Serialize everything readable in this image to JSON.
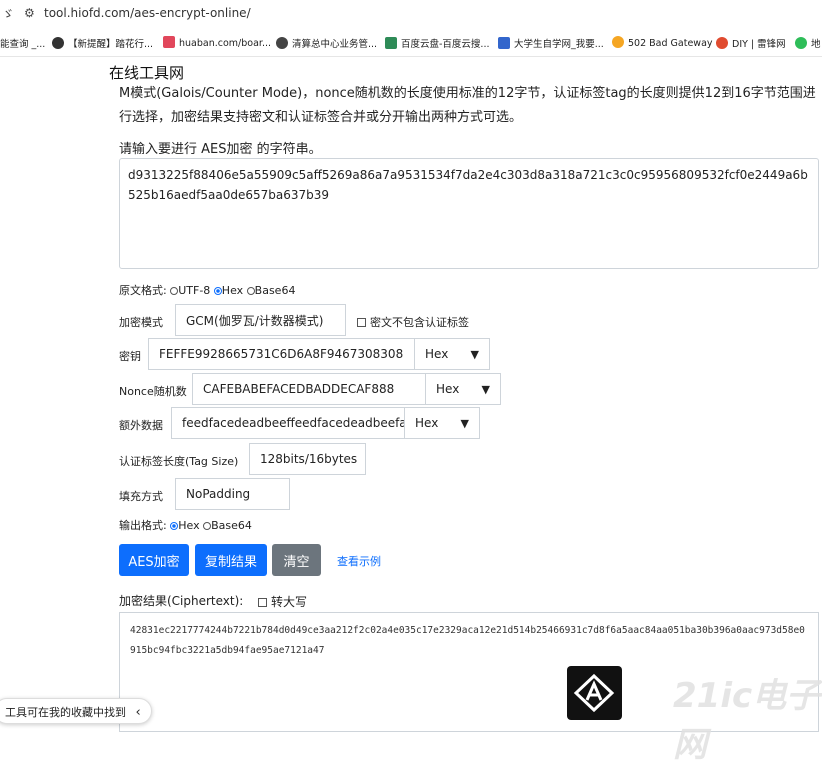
{
  "browser": {
    "url": "tool.hiofd.com/aes-encrypt-online/",
    "bookmarks": [
      {
        "label": "能查询 _...",
        "color": ""
      },
      {
        "label": "【新提醒】踏花行...",
        "color": "#333333"
      },
      {
        "label": "huaban.com/boar...",
        "color": "#e1475b"
      },
      {
        "label": "清算总中心业务管...",
        "color": "#444444"
      },
      {
        "label": "百度云盘-百度云搜...",
        "color": "#2e8b57"
      },
      {
        "label": "大学生自学网_我要...",
        "color": "#3366cc"
      },
      {
        "label": "502 Bad Gateway",
        "color": "#f5a623"
      },
      {
        "label": "DIY | 雷锋网",
        "color": "#e04b2f"
      },
      {
        "label": "地",
        "color": "#2ebd59"
      }
    ]
  },
  "site_title": "在线工具网",
  "description": "M模式(Galois/Counter Mode)，nonce随机数的长度使用标准的12字节，认证标签tag的长度则提供12到16字节范围进行选择，加密结果支持密文和认证标签合并或分开输出两种方式可选。",
  "input_prompt": "请输入要进行 AES加密 的字符串。",
  "input_value": "d9313225f88406e5a55909c5aff5269a86a7a9531534f7da2e4c303d8a318a721c3c0c95956809532fcf0e2449a6b525b16aedf5aa0de657ba637b39",
  "plaintext_format": {
    "label": "原文格式:",
    "options": [
      "UTF-8",
      "Hex",
      "Base64"
    ],
    "selected": "Hex"
  },
  "mode": {
    "label": "加密模式",
    "value": "GCM(伽罗瓦/计数器模式)",
    "checkbox_label": "密文不包含认证标签"
  },
  "key": {
    "label": "密钥",
    "value": "FEFFE9928665731C6D6A8F9467308308",
    "encoding": "Hex"
  },
  "nonce": {
    "label": "Nonce随机数",
    "value": "CAFEBABEFACEDBADDECAF888",
    "encoding": "Hex"
  },
  "aad": {
    "label": "额外数据",
    "value": "feedfacedeadbeeffeedfacedeadbeefabaddad2",
    "encoding": "Hex"
  },
  "tag_size": {
    "label": "认证标签长度(Tag Size)",
    "value": "128bits/16bytes"
  },
  "padding": {
    "label": "填充方式",
    "value": "NoPadding"
  },
  "output_format": {
    "label": "输出格式:",
    "options": [
      "Hex",
      "Base64"
    ],
    "selected": "Hex"
  },
  "buttons": {
    "encrypt": "AES加密",
    "copy": "复制结果",
    "clear": "清空",
    "example": "查看示例"
  },
  "result": {
    "label": "加密结果(Ciphertext):",
    "uppercase_label": "转大写",
    "value": "42831ec2217774244b7221b784d0d49ce3aa212f2c02a4e035c17e2329aca12e21d514b25466931c7d8f6a5aac84aa051ba30b396a0aac973d58e0915bc94fbc3221a5db94fae95ae7121a47"
  },
  "favorites_tip": "工具可在我的收藏中找到",
  "watermark": "21ic电子网",
  "colors": {
    "primary": "#0d6efd",
    "secondary": "#6c757d",
    "border": "#ced4da"
  }
}
